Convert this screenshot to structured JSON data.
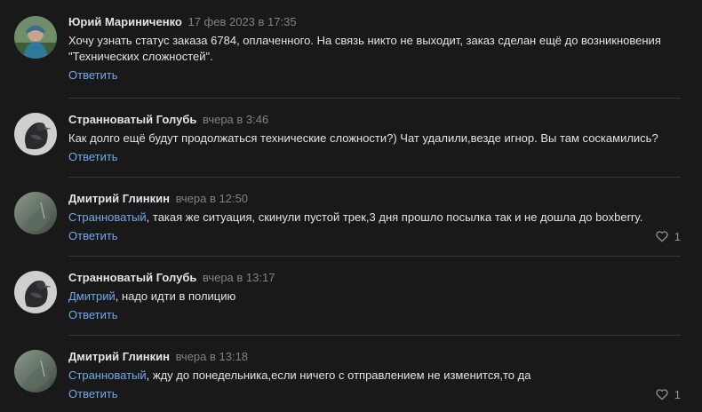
{
  "comments": [
    {
      "author": "Юрий Мариниченко",
      "date": "17 фев 2023 в 17:35",
      "text": "Хочу узнать статус заказа 6784, оплаченного. На связь никто не выходит, заказ сделан ещё до возникновения \"Технических сложностей\".",
      "reply_label": "Ответить"
    },
    {
      "author": "Странноватый Голубь",
      "date": "вчера в 3:46",
      "text": "Как долго ещё будут продолжаться технические сложности?) Чат удалили,везде игнор. Вы там соскамились?",
      "reply_label": "Ответить"
    },
    {
      "author": "Дмитрий Глинкин",
      "date": "вчера в 12:50",
      "mention": "Странноватый",
      "text": ", такая же ситуация, скинули пустой трек,3 дня прошло посылка так и не дошла до boxberry.",
      "reply_label": "Ответить",
      "likes": "1"
    },
    {
      "author": "Странноватый Голубь",
      "date": "вчера в 13:17",
      "mention": "Дмитрий",
      "text": ", надо идти в полицию",
      "reply_label": "Ответить"
    },
    {
      "author": "Дмитрий Глинкин",
      "date": "вчера в 13:18",
      "mention": "Странноватый",
      "text": ", жду до понедельника,если ничего с отправлением не изменится,то да",
      "reply_label": "Ответить",
      "likes": "1"
    }
  ],
  "icons": {
    "like": "heart-outline-icon"
  },
  "colors": {
    "background": "#191919",
    "link": "#71aaeb",
    "muted": "#828282",
    "divider": "#363738"
  }
}
